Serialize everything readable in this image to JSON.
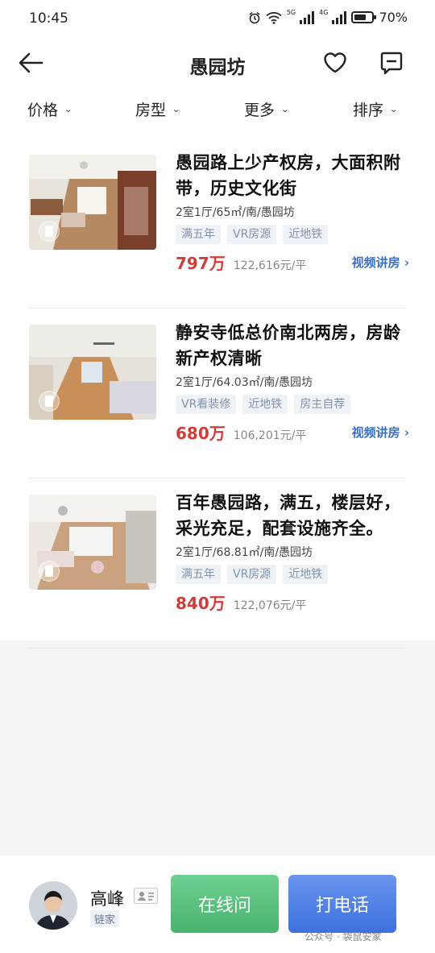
{
  "status_bar": {
    "time": "10:45",
    "battery_percent": "70%",
    "battery_level": 0.7,
    "sig1_label": "5G",
    "sig2_label": "4G"
  },
  "header": {
    "title": "愚园坊"
  },
  "filters": [
    {
      "label": "价格"
    },
    {
      "label": "房型"
    },
    {
      "label": "更多"
    },
    {
      "label": "排序"
    }
  ],
  "listings": [
    {
      "title": "愚园路上少产权房，大面积附带，历史文化街",
      "meta": "2室1厅/65㎡/南/愚园坊",
      "tags": [
        "满五年",
        "VR房源",
        "近地铁"
      ],
      "price": "797万",
      "unit_price": "122,616元/平",
      "video_link": "视频讲房 ›"
    },
    {
      "title": "静安寺低总价南北两房，房龄新产权清晰",
      "meta": "2室1厅/64.03㎡/南/愚园坊",
      "tags": [
        "VR看装修",
        "近地铁",
        "房主自荐"
      ],
      "price": "680万",
      "unit_price": "106,201元/平",
      "video_link": "视频讲房 ›"
    },
    {
      "title": "百年愚园路，满五，楼层好，采光充足，配套设施齐全。",
      "meta": "2室1厅/68.81㎡/南/愚园坊",
      "tags": [
        "满五年",
        "VR房源",
        "近地铁"
      ],
      "price": "840万",
      "unit_price": "122,076元/平",
      "video_link": ""
    }
  ],
  "agent": {
    "name": "高峰",
    "company": "链家"
  },
  "actions": {
    "chat_label": "在线问",
    "call_label": "打电话"
  },
  "watermark": "公众号 · 袋鼠安家",
  "colors": {
    "price": "#d13c38",
    "link": "#3a6fc9",
    "chat_button": "#5bc27f",
    "call_button": "#4f80e6"
  }
}
